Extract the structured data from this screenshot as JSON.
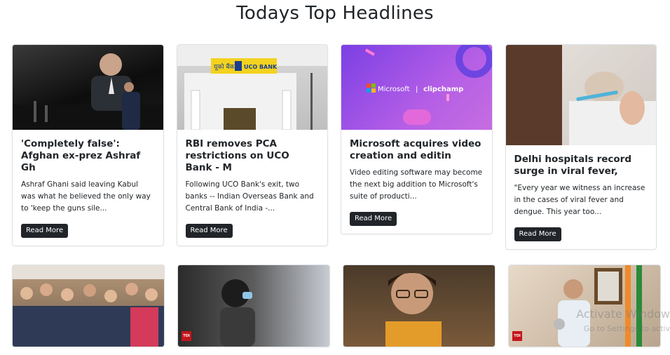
{
  "page": {
    "title": "Todays Top Headlines"
  },
  "cards": [
    {
      "title": "'Completely false': Afghan ex-prez Ashraf Gh",
      "description": "Ashraf Ghani said leaving Kabul was what he believed the only way to 'keep the guns sile...",
      "button": "Read More"
    },
    {
      "title": "RBI removes PCA restrictions on UCO Bank - M",
      "description": "Following UCO Bank's exit, two banks -- Indian Overseas Bank and Central Bank of India -...",
      "button": "Read More",
      "image_text": {
        "sign_left": "यूको बैंक",
        "sign_right": "UCO BANK"
      }
    },
    {
      "title": "Microsoft acquires video creation and editin",
      "description": "Video editing software may become the next big addition to Microsoft's suite of producti...",
      "button": "Read More",
      "image_text": {
        "brand": "Microsoft",
        "separator": "|",
        "product": "clipchamp"
      }
    },
    {
      "title": "Delhi hospitals record surge in viral fever,",
      "description": "\"Every year we witness an increase in the cases of viral fever and dengue. This year too...",
      "button": "Read More"
    }
  ],
  "row2_cards": [
    {
      "badge": ""
    },
    {
      "badge": "TOI"
    },
    {
      "badge": ""
    },
    {
      "badge": "TOI"
    }
  ],
  "watermark": {
    "line1": "Activate Window",
    "line2": "Go to Settings to activ"
  }
}
